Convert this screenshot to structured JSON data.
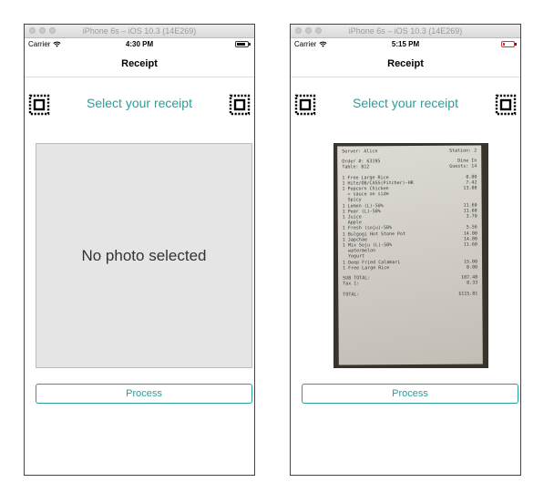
{
  "colors": {
    "accent": "#2a9d9a",
    "battery_full": "#111111",
    "battery_low": "#d9342b"
  },
  "simulators": [
    {
      "window_title": "iPhone 6s – iOS 10.3 (14E269)",
      "carrier": "Carrier",
      "time": "4:30 PM",
      "battery_level": 0.85,
      "nav_title": "Receipt",
      "select_label": "Select your receipt",
      "placeholder": "No photo selected",
      "process_label": "Process",
      "icons": [
        "scan-icon",
        "wifi-icon",
        "battery-icon"
      ]
    },
    {
      "window_title": "iPhone 6s – iOS 10.3 (14E269)",
      "carrier": "Carrier",
      "time": "5:15 PM",
      "battery_level": 0.15,
      "nav_title": "Receipt",
      "select_label": "Select your receipt",
      "process_label": "Process",
      "receipt": {
        "server": "Server: Alice",
        "station": "Station: 2",
        "order": "Order #: 63195",
        "dine": "Dine In",
        "table": "Table: B12",
        "guests": "Guests: 14",
        "items": [
          {
            "text": "1 Free Large Rice",
            "price": "0.00"
          },
          {
            "text": "1 Hite/OB/CASS(Pitcher)-HR",
            "price": "7.42"
          },
          {
            "text": "1 Popcorn Chicken",
            "price": "13.00"
          },
          {
            "text": "  > sauce on side",
            "price": ""
          },
          {
            "text": "  Spicy",
            "price": ""
          },
          {
            "text": "1 Lemon (L)-50%",
            "price": "11.60"
          },
          {
            "text": "1 Pear (L)-50%",
            "price": "11.60"
          },
          {
            "text": "1 Juice",
            "price": "3.70"
          },
          {
            "text": "  Apple",
            "price": ""
          },
          {
            "text": "1 Fresh (soju)-50%",
            "price": "5.56"
          },
          {
            "text": "1 Bulgogi Hot Stone Pot",
            "price": "14.00"
          },
          {
            "text": "1 Japchae",
            "price": "14.00"
          },
          {
            "text": "1 Mix Soju (L)-50%",
            "price": "11.60"
          },
          {
            "text": "  watermelon",
            "price": ""
          },
          {
            "text": "  Yogurt",
            "price": ""
          },
          {
            "text": "1 Deep Fried Calamari",
            "price": "15.00"
          },
          {
            "text": "1 Free Large Rice",
            "price": "0.00"
          }
        ],
        "subtotal_label": "SUB TOTAL:",
        "subtotal": "107.48",
        "tax_label": "Tax 1:",
        "tax": "8.33",
        "total_label": "TOTAL:",
        "total": "$115.81"
      }
    }
  ]
}
